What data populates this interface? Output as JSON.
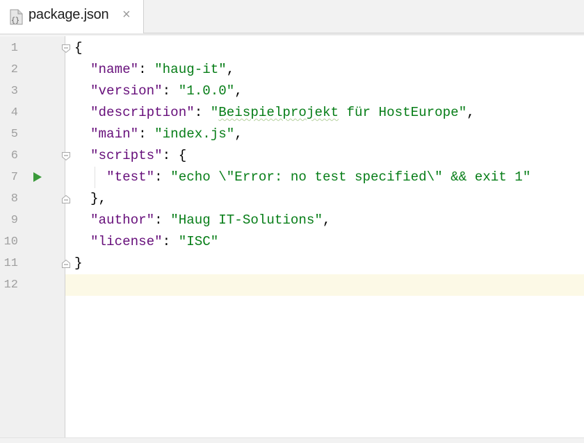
{
  "tab": {
    "label": "package.json",
    "file_icon": "json-file-icon",
    "close_symbol": "×"
  },
  "editor": {
    "current_line": 12,
    "lines": [
      {
        "n": "1",
        "tokens": [
          {
            "t": "p",
            "v": "{"
          }
        ]
      },
      {
        "n": "2",
        "tokens": [
          {
            "t": "p",
            "v": "  "
          },
          {
            "t": "k",
            "v": "\"name\""
          },
          {
            "t": "p",
            "v": ": "
          },
          {
            "t": "s",
            "v": "\"haug-it\""
          },
          {
            "t": "p",
            "v": ","
          }
        ]
      },
      {
        "n": "3",
        "tokens": [
          {
            "t": "p",
            "v": "  "
          },
          {
            "t": "k",
            "v": "\"version\""
          },
          {
            "t": "p",
            "v": ": "
          },
          {
            "t": "s",
            "v": "\"1.0.0\""
          },
          {
            "t": "p",
            "v": ","
          }
        ]
      },
      {
        "n": "4",
        "tokens": [
          {
            "t": "p",
            "v": "  "
          },
          {
            "t": "k",
            "v": "\"description\""
          },
          {
            "t": "p",
            "v": ": "
          },
          {
            "t": "s",
            "v": "\""
          },
          {
            "t": "sq",
            "v": "Beispielprojekt"
          },
          {
            "t": "s",
            "v": " für HostEurope\""
          },
          {
            "t": "p",
            "v": ","
          }
        ]
      },
      {
        "n": "5",
        "tokens": [
          {
            "t": "p",
            "v": "  "
          },
          {
            "t": "k",
            "v": "\"main\""
          },
          {
            "t": "p",
            "v": ": "
          },
          {
            "t": "s",
            "v": "\"index.js\""
          },
          {
            "t": "p",
            "v": ","
          }
        ]
      },
      {
        "n": "6",
        "tokens": [
          {
            "t": "p",
            "v": "  "
          },
          {
            "t": "k",
            "v": "\"scripts\""
          },
          {
            "t": "p",
            "v": ": {"
          }
        ]
      },
      {
        "n": "7",
        "tokens": [
          {
            "t": "p",
            "v": "    "
          },
          {
            "t": "k",
            "v": "\"test\""
          },
          {
            "t": "p",
            "v": ": "
          },
          {
            "t": "s",
            "v": "\"echo \\\"Error: no test specified\\\" && exit 1\""
          }
        ]
      },
      {
        "n": "8",
        "tokens": [
          {
            "t": "p",
            "v": "  },"
          }
        ]
      },
      {
        "n": "9",
        "tokens": [
          {
            "t": "p",
            "v": "  "
          },
          {
            "t": "k",
            "v": "\"author\""
          },
          {
            "t": "p",
            "v": ": "
          },
          {
            "t": "s",
            "v": "\"Haug IT-Solutions\""
          },
          {
            "t": "p",
            "v": ","
          }
        ]
      },
      {
        "n": "10",
        "tokens": [
          {
            "t": "p",
            "v": "  "
          },
          {
            "t": "k",
            "v": "\"license\""
          },
          {
            "t": "p",
            "v": ": "
          },
          {
            "t": "s",
            "v": "\"ISC\""
          }
        ]
      },
      {
        "n": "11",
        "tokens": [
          {
            "t": "p",
            "v": "}"
          }
        ]
      },
      {
        "n": "12",
        "tokens": []
      }
    ],
    "fold_markers": [
      {
        "line": 1,
        "kind": "fold-open-icon"
      },
      {
        "line": 6,
        "kind": "fold-open-icon"
      },
      {
        "line": 8,
        "kind": "fold-close-icon"
      },
      {
        "line": 11,
        "kind": "fold-close-icon"
      }
    ],
    "run_gutter": {
      "line": 7,
      "icon": "run-test-icon",
      "color": "#3a9a3a"
    }
  },
  "colors": {
    "key": "#660e7a",
    "string": "#067d17",
    "current_line_bg": "#fcf9e6",
    "gutter_bg": "#f0f0f0"
  }
}
